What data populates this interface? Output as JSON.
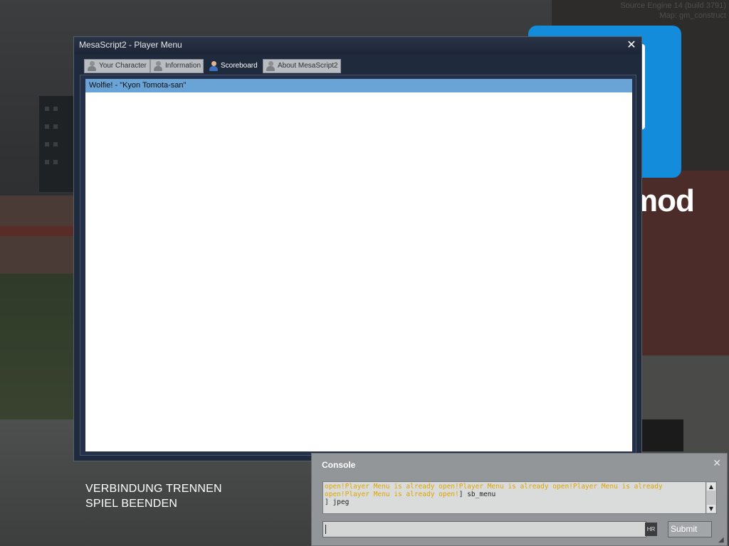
{
  "hud": {
    "engine_line": "Source Engine 14 (build 3791)",
    "map_line": "Map: gm_construct",
    "brand_text": "mod"
  },
  "main_menu": {
    "disconnect": "VERBINDUNG TRENNEN",
    "quit": "SPIEL BEENDEN"
  },
  "player_menu": {
    "title": "MesaScript2 - Player Menu",
    "close_glyph": "✕",
    "tabs": [
      {
        "label": "Your Character",
        "active": false
      },
      {
        "label": "Information",
        "active": false
      },
      {
        "label": "Scoreboard",
        "active": true
      },
      {
        "label": "About MesaScript2",
        "active": false
      }
    ],
    "rows": [
      {
        "text": "Wolfie! - \"Kyon Tomota-san\"",
        "selected": true
      }
    ]
  },
  "console": {
    "title": "Console",
    "close_glyph": "✕",
    "log_warn_1": "open!Player Menu is already open!Player Menu is already open!Player Menu is already",
    "log_warn_2": "open!Player Menu is already open!",
    "log_cmd_1": "] sb_menu",
    "log_cmd_2": "] jpeg",
    "input_value": "",
    "hr_label": "HR",
    "submit_label": "Submit",
    "scroll_up_glyph": "▲",
    "scroll_down_glyph": "▼",
    "resize_glyph": "◢"
  },
  "colors": {
    "warn_text": "#e0a400",
    "selected_row": "#6aa4d6",
    "window_bg": "#1f2a3c",
    "brand_blue": "#138ddb"
  },
  "icons": [
    "close-icon",
    "user-icon",
    "scroll-up-icon",
    "scroll-down-icon",
    "resize-grip-icon"
  ]
}
